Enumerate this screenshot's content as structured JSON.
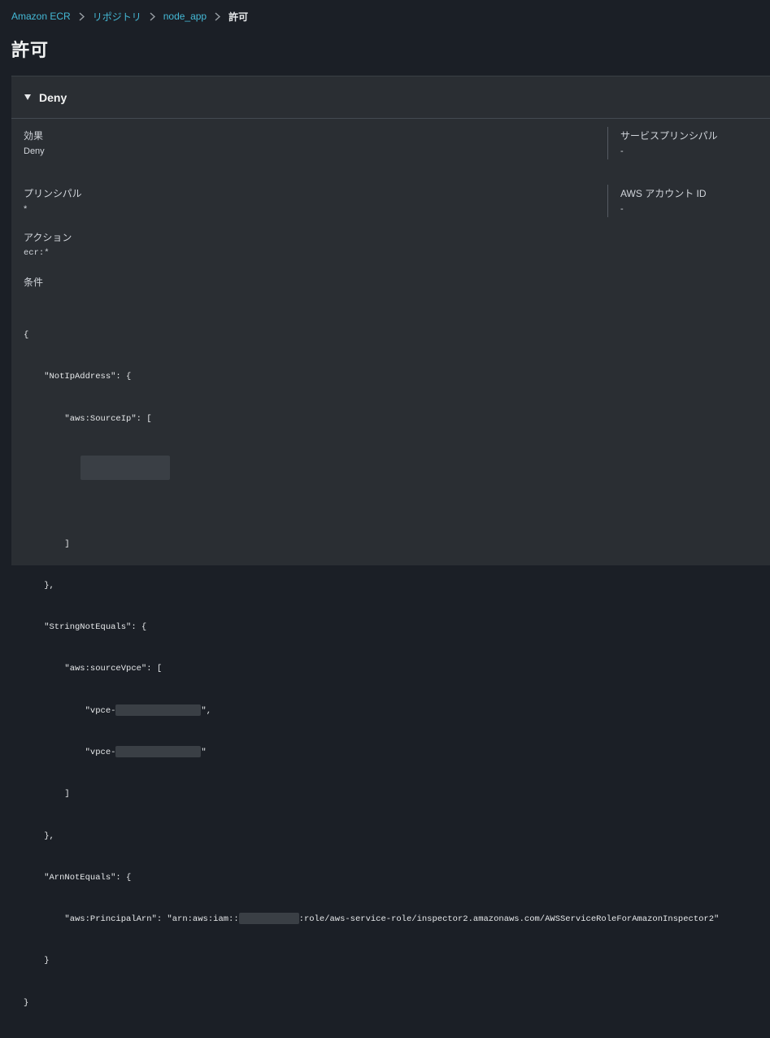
{
  "breadcrumb": {
    "items": [
      "Amazon ECR",
      "リポジトリ",
      "node_app"
    ],
    "current": "許可"
  },
  "page_title": "許可",
  "panel": {
    "title": "Deny",
    "effect_label": "効果",
    "effect_value": "Deny",
    "service_principal_label": "サービスプリンシパル",
    "service_principal_value": "-",
    "principal_label": "プリンシパル",
    "principal_value": "*",
    "account_id_label": "AWS アカウント ID",
    "account_id_value": "-",
    "action_label": "アクション",
    "action_value": "ecr:*",
    "condition_label": "条件"
  },
  "condition_code": {
    "l1": "{",
    "l2": "    \"NotIpAddress\": {",
    "l3": "        \"aws:SourceIp\": [",
    "l5": "        ]",
    "l6": "    },",
    "l7": "    \"StringNotEquals\": {",
    "l8": "        \"aws:sourceVpce\": [",
    "l9a": "            \"vpce-",
    "l9b": "\",",
    "l10a": "            \"vpce-",
    "l10b": "\"",
    "l11": "        ]",
    "l12": "    },",
    "l13": "    \"ArnNotEquals\": {",
    "l14a": "        \"aws:PrincipalArn\": \"arn:aws:iam::",
    "l14b": ":role/aws-service-role/inspector2.amazonaws.com/AWSServiceRoleForAmazonInspector2\"",
    "l15": "    }",
    "l16": "}"
  },
  "colors": {
    "background": "#1b1f26",
    "panel": "#2a2e33",
    "link": "#44b9d6"
  }
}
